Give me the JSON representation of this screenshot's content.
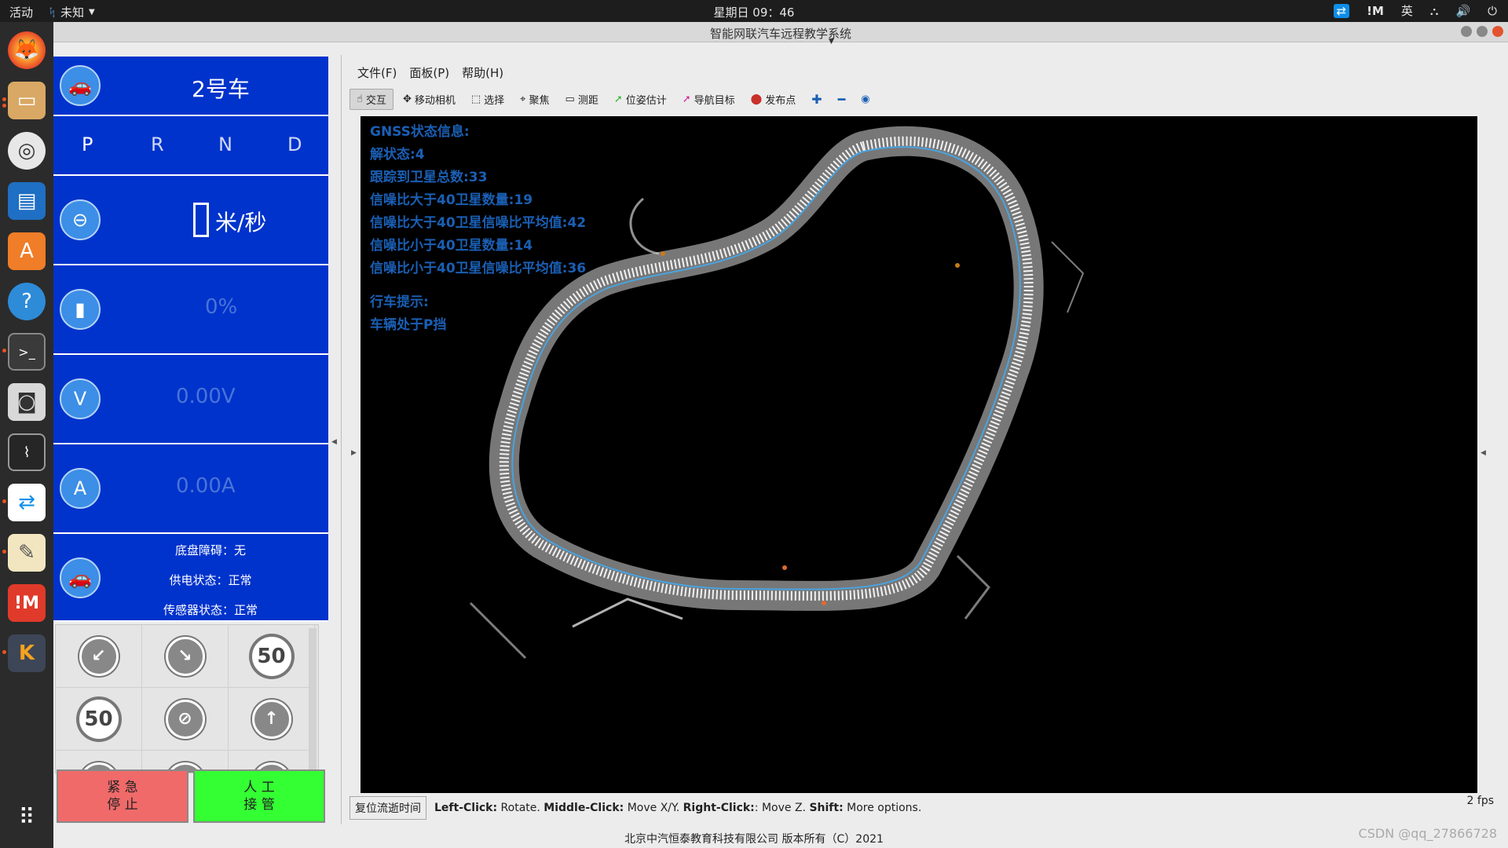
{
  "topbar": {
    "activities": "活动",
    "app_name": "未知",
    "clock": "星期日 09：46",
    "tray_im": "!M",
    "tray_lang": "英"
  },
  "window": {
    "title": "智能网联汽车远程教学系统"
  },
  "dock": [
    "firefox-icon",
    "files-icon",
    "rhythmbox-icon",
    "writer-icon",
    "software-icon",
    "help-icon",
    "terminal-icon",
    "camera-icon",
    "monitor-icon",
    "teamviewer-icon",
    "text-editor-icon",
    "im-icon",
    "kylin-icon"
  ],
  "panel": {
    "car_name": "2号车",
    "gears": [
      "P",
      "R",
      "N",
      "D"
    ],
    "speed_unit": "米/秒",
    "battery_pct": "0%",
    "voltage": "0.00V",
    "current": "0.00A",
    "chassis_fault": "底盘障碍：无",
    "power_status": "供电状态：正常",
    "sensor_status": "传感器状态：正常",
    "signs": [
      "↙",
      "↘",
      "50",
      "50",
      "⊘",
      "↑",
      "",
      "",
      ""
    ],
    "estop": "紧 急\n停 止",
    "takeover": "人 工\n接 管"
  },
  "rviz": {
    "menu": [
      "文件(F)",
      "面板(P)",
      "帮助(H)"
    ],
    "tools": [
      {
        "icon": "hand-icon",
        "label": "交互"
      },
      {
        "icon": "camera-move-icon",
        "label": "移动相机"
      },
      {
        "icon": "select-icon",
        "label": "选择"
      },
      {
        "icon": "focus-icon",
        "label": "聚焦"
      },
      {
        "icon": "measure-icon",
        "label": "测距"
      },
      {
        "icon": "pose-estimate-icon",
        "label": "位姿估计"
      },
      {
        "icon": "nav-goal-icon",
        "label": "导航目标"
      },
      {
        "icon": "publish-point-icon",
        "label": "发布点"
      }
    ],
    "overlay": {
      "gnss_title": "GNSS状态信息:",
      "solution": "解状态:4",
      "tracked": "跟踪到卫星总数:33",
      "snr_above_count": "信噪比大于40卫星数量:19",
      "snr_above_avg": "信噪比大于40卫星信噪比平均值:42",
      "snr_below_count": "信噪比小于40卫星数量:14",
      "snr_below_avg": "信噪比小于40卫星信噪比平均值:36",
      "hint_title": "行车提示:",
      "hint": "车辆处于P挡"
    },
    "reset_time": "复位流逝时间",
    "help_left": "Left-Click:",
    "help_left_d": " Rotate. ",
    "help_mid": "Middle-Click:",
    "help_mid_d": " Move X/Y. ",
    "help_right": "Right-Click:",
    "help_right_d": ": Move Z. ",
    "help_shift": "Shift:",
    "help_shift_d": " More options.",
    "fps": "2 fps"
  },
  "footer": "北京中汽恒泰教育科技有限公司 版本所有（C）2021",
  "watermark": "CSDN @qq_27866728",
  "colors": {
    "panel_blue": "#0033cc",
    "estop": "#f06a6a",
    "takeover": "#33ff33",
    "overlay_text": "#1a5fb4"
  }
}
